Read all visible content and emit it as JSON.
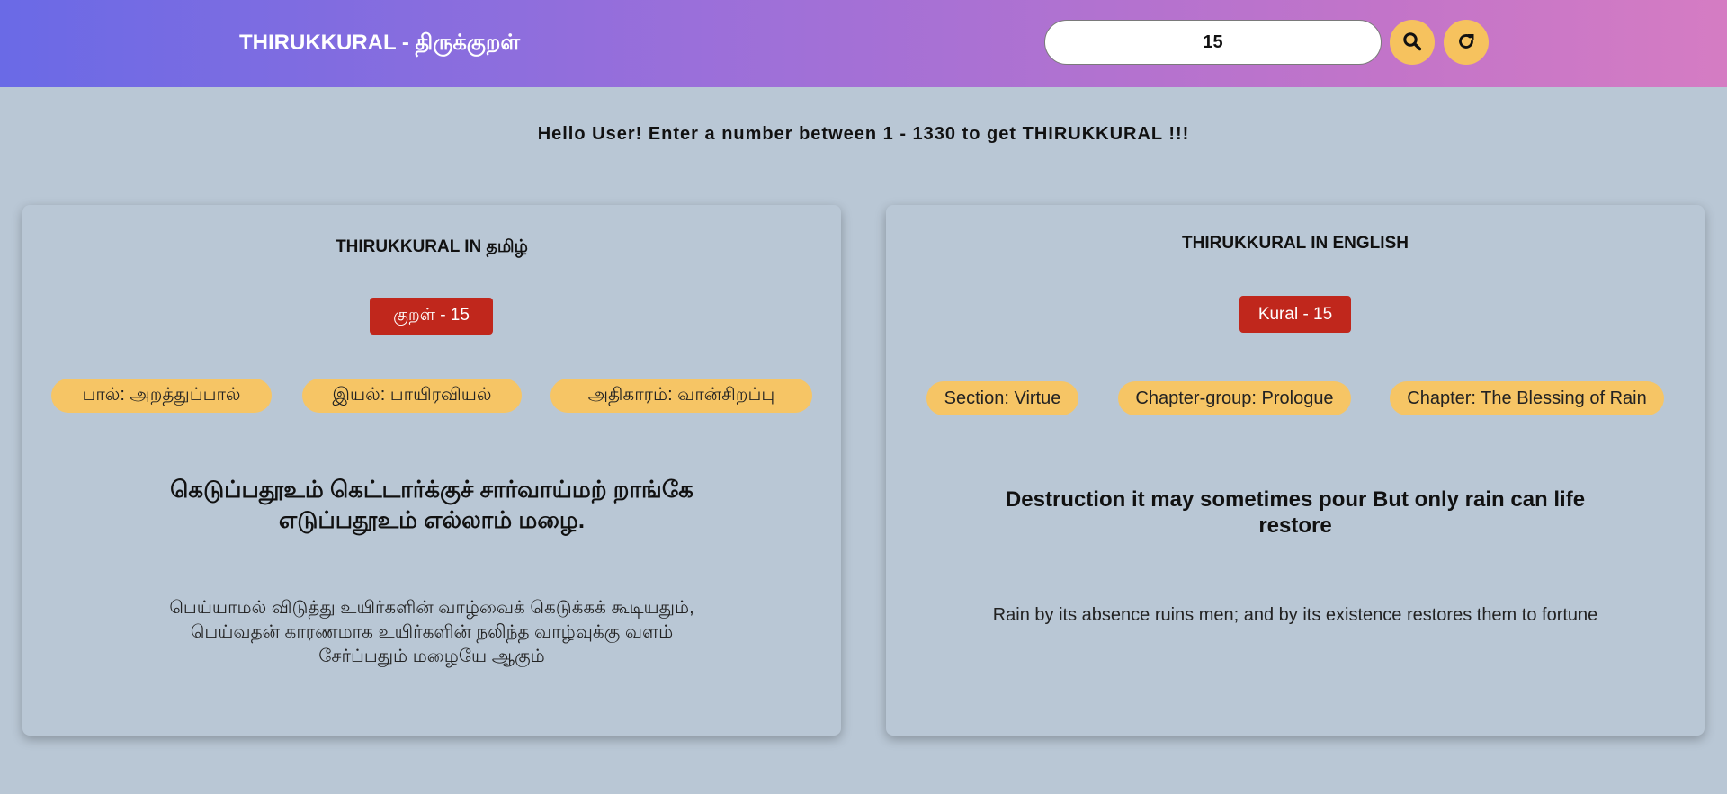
{
  "header": {
    "brand": "THIRUKKURAL - திருக்குறள்",
    "search_value": "15",
    "search_icon": "search-icon",
    "refresh_icon": "refresh-icon",
    "accent_color": "#f6c25e"
  },
  "greeting": "Hello User! Enter a number between 1 - 1330 to get THIRUKKURAL !!!",
  "tamil_card": {
    "title": "THIRUKKURAL IN தமிழ்",
    "kural_label": "குறள் - 15",
    "tags": [
      "பால்: அறத்துப்பால்",
      "இயல்: பாயிரவியல்",
      "அதிகாரம்: வான்சிறப்பு"
    ],
    "verse_line1": "கெடுப்பதூஉம் கெட்டார்க்குச் சார்வாய்மற் றாங்கே",
    "verse_line2": "எடுப்பதூஉம் எல்லாம் மழை.",
    "meaning_line1": "பெய்யாமல் விடுத்து உயிர்களின் வாழ்வைக் கெடுக்கக் கூடியதும்,",
    "meaning_line2": "பெய்வதன் காரணமாக உயிர்களின் நலிந்த வாழ்வுக்கு வளம்",
    "meaning_line3": "சேர்ப்பதும் மழையே ஆகும்"
  },
  "english_card": {
    "title": "THIRUKKURAL IN ENGLISH",
    "kural_label": "Kural - 15",
    "tags": [
      "Section: Virtue",
      "Chapter-group: Prologue",
      "Chapter: The Blessing of Rain"
    ],
    "verse_line1": "Destruction it may sometimes pour But only rain can life",
    "verse_line2": "restore",
    "meaning": "Rain by its absence ruins men; and by its existence restores them to fortune"
  },
  "colors": {
    "badge": "#c0271c",
    "pill": "#f6c565",
    "background": "#b9c7d5"
  }
}
